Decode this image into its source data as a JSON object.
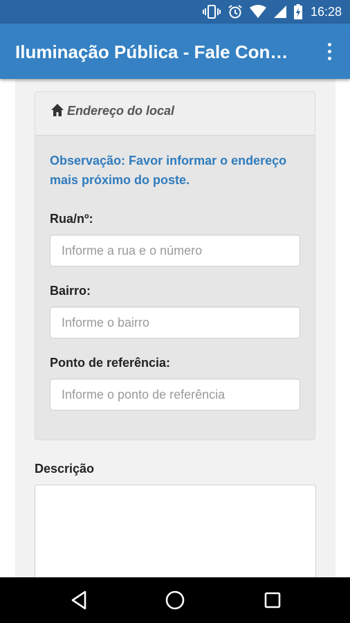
{
  "status_bar": {
    "time": "16:28",
    "icons": [
      "vibrate-icon",
      "alarm-icon",
      "wifi-icon",
      "signal-icon",
      "battery-charging-icon"
    ]
  },
  "app_bar": {
    "title": "Iluminação Pública - Fale Conosco",
    "overflow_icon": "more-vert-icon"
  },
  "address_panel": {
    "heading": "Endereço do local",
    "heading_icon": "home-icon",
    "observation": "Observação: Favor informar o endereço mais próximo do poste.",
    "fields": [
      {
        "label": "Rua/nº:",
        "placeholder": "Informe a rua e o número",
        "value": ""
      },
      {
        "label": "Bairro:",
        "placeholder": "Informe o bairro",
        "value": ""
      },
      {
        "label": "Ponto de referência:",
        "placeholder": "Informe o ponto de referência",
        "value": ""
      }
    ]
  },
  "description": {
    "label": "Descrição",
    "value": ""
  },
  "nav_bar": {
    "buttons": [
      "back-icon",
      "home-circle-icon",
      "recents-icon"
    ]
  },
  "colors": {
    "status_bar": "#2a66a3",
    "app_bar": "#3581c3",
    "observation_text": "#2f7bbd"
  }
}
